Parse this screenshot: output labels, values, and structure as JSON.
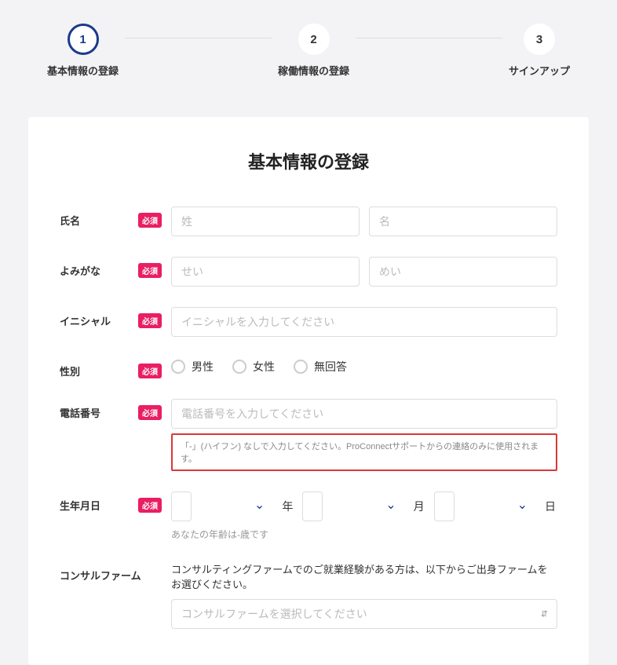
{
  "stepper": {
    "steps": [
      {
        "num": "1",
        "label": "基本情報の登録",
        "active": true
      },
      {
        "num": "2",
        "label": "稼働情報の登録",
        "active": false
      },
      {
        "num": "3",
        "label": "サインアップ",
        "active": false
      }
    ]
  },
  "form": {
    "title": "基本情報の登録",
    "required_badge": "必須",
    "fields": {
      "name": {
        "label": "氏名",
        "sei_placeholder": "姓",
        "mei_placeholder": "名"
      },
      "yomigana": {
        "label": "よみがな",
        "sei_placeholder": "せい",
        "mei_placeholder": "めい"
      },
      "initial": {
        "label": "イニシャル",
        "placeholder": "イニシャルを入力してください"
      },
      "gender": {
        "label": "性別",
        "options": {
          "male": "男性",
          "female": "女性",
          "noanswer": "無回答"
        }
      },
      "phone": {
        "label": "電話番号",
        "placeholder": "電話番号を入力してください",
        "hint": "「-」(ハイフン) なしで入力してください。ProConnectサポートからの連絡のみに使用されます。"
      },
      "birthdate": {
        "label": "生年月日",
        "year_unit": "年",
        "month_unit": "月",
        "day_unit": "日",
        "age_hint": "あなたの年齢は-歳です"
      },
      "firm": {
        "label": "コンサルファーム",
        "desc": "コンサルティングファームでのご就業経験がある方は、以下からご出身ファームをお選びください。",
        "placeholder": "コンサルファームを選択してください"
      }
    }
  }
}
